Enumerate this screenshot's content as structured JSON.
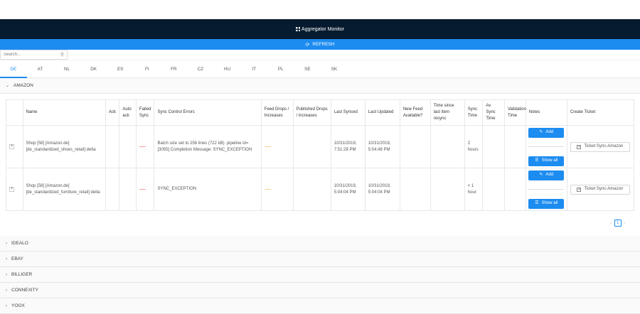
{
  "header": {
    "title": "Aggregator Monitor",
    "refresh_label": "REFRESH"
  },
  "search": {
    "placeholder": "Search...",
    "value": ""
  },
  "tabs": [
    "DE",
    "AT",
    "NL",
    "DK",
    "ES",
    "FI",
    "FR",
    "CZ",
    "HU",
    "IT",
    "PL",
    "SE",
    "SK"
  ],
  "active_tab": "DE",
  "sections": {
    "amazon": "AMAZON",
    "others": [
      "IDEALO",
      "EBAY",
      "BILLIGER",
      "CONNEXITY",
      "YOOX"
    ]
  },
  "table": {
    "headers": {
      "name": "Name",
      "ack": "Ack",
      "auto_ack": "Auto ack",
      "failed_sync": "Failed Sync",
      "sync_control_errors": "Sync Control Errors",
      "feed_drops": "Feed Drops / Increases",
      "published_drops": "Published Drops / increases",
      "last_synced": "Last Synced",
      "last_updated": "Last Updated",
      "new_feed": "New Feed Available?",
      "time_since": "Time since last item resync",
      "sync_time": "Sync Time",
      "av_sync_time": "Av Sync Time",
      "validation_time": "Validation Time",
      "notes": "Notes",
      "create_ticket": "Create Ticket"
    },
    "rows": [
      {
        "name": "Shop [58] [Amazon.de] [de_standardized_shoes_retail] delta",
        "errors": "Batch size set to 256 lines (722 kB). pipeline id= [3055] Completion Message: SYNC_EXCEPTION",
        "last_synced": "10/31/2019, 7:51:28 PM",
        "last_updated": "10/31/2019, 5:04:48 PM",
        "sync_time": "2 hours",
        "add_label": "Add",
        "show_all_label": "Show all",
        "ticket_label": "Ticket Sync-Amazon"
      },
      {
        "name": "Shop [58] [Amazon.de] [de_standardized_furniture_retail] delta",
        "errors": "SYNC_EXCEPTION",
        "last_synced": "10/31/2019, 5:04:04 PM",
        "last_updated": "10/31/2019, 5:04:04 PM",
        "sync_time": "< 1 hour",
        "add_label": "Add",
        "show_all_label": "Show all",
        "ticket_label": "Ticket Sync-Amazon"
      }
    ]
  },
  "pagination": {
    "current": "1"
  },
  "colors": {
    "header_bg": "#061b2f",
    "accent": "#1c8cf0"
  }
}
